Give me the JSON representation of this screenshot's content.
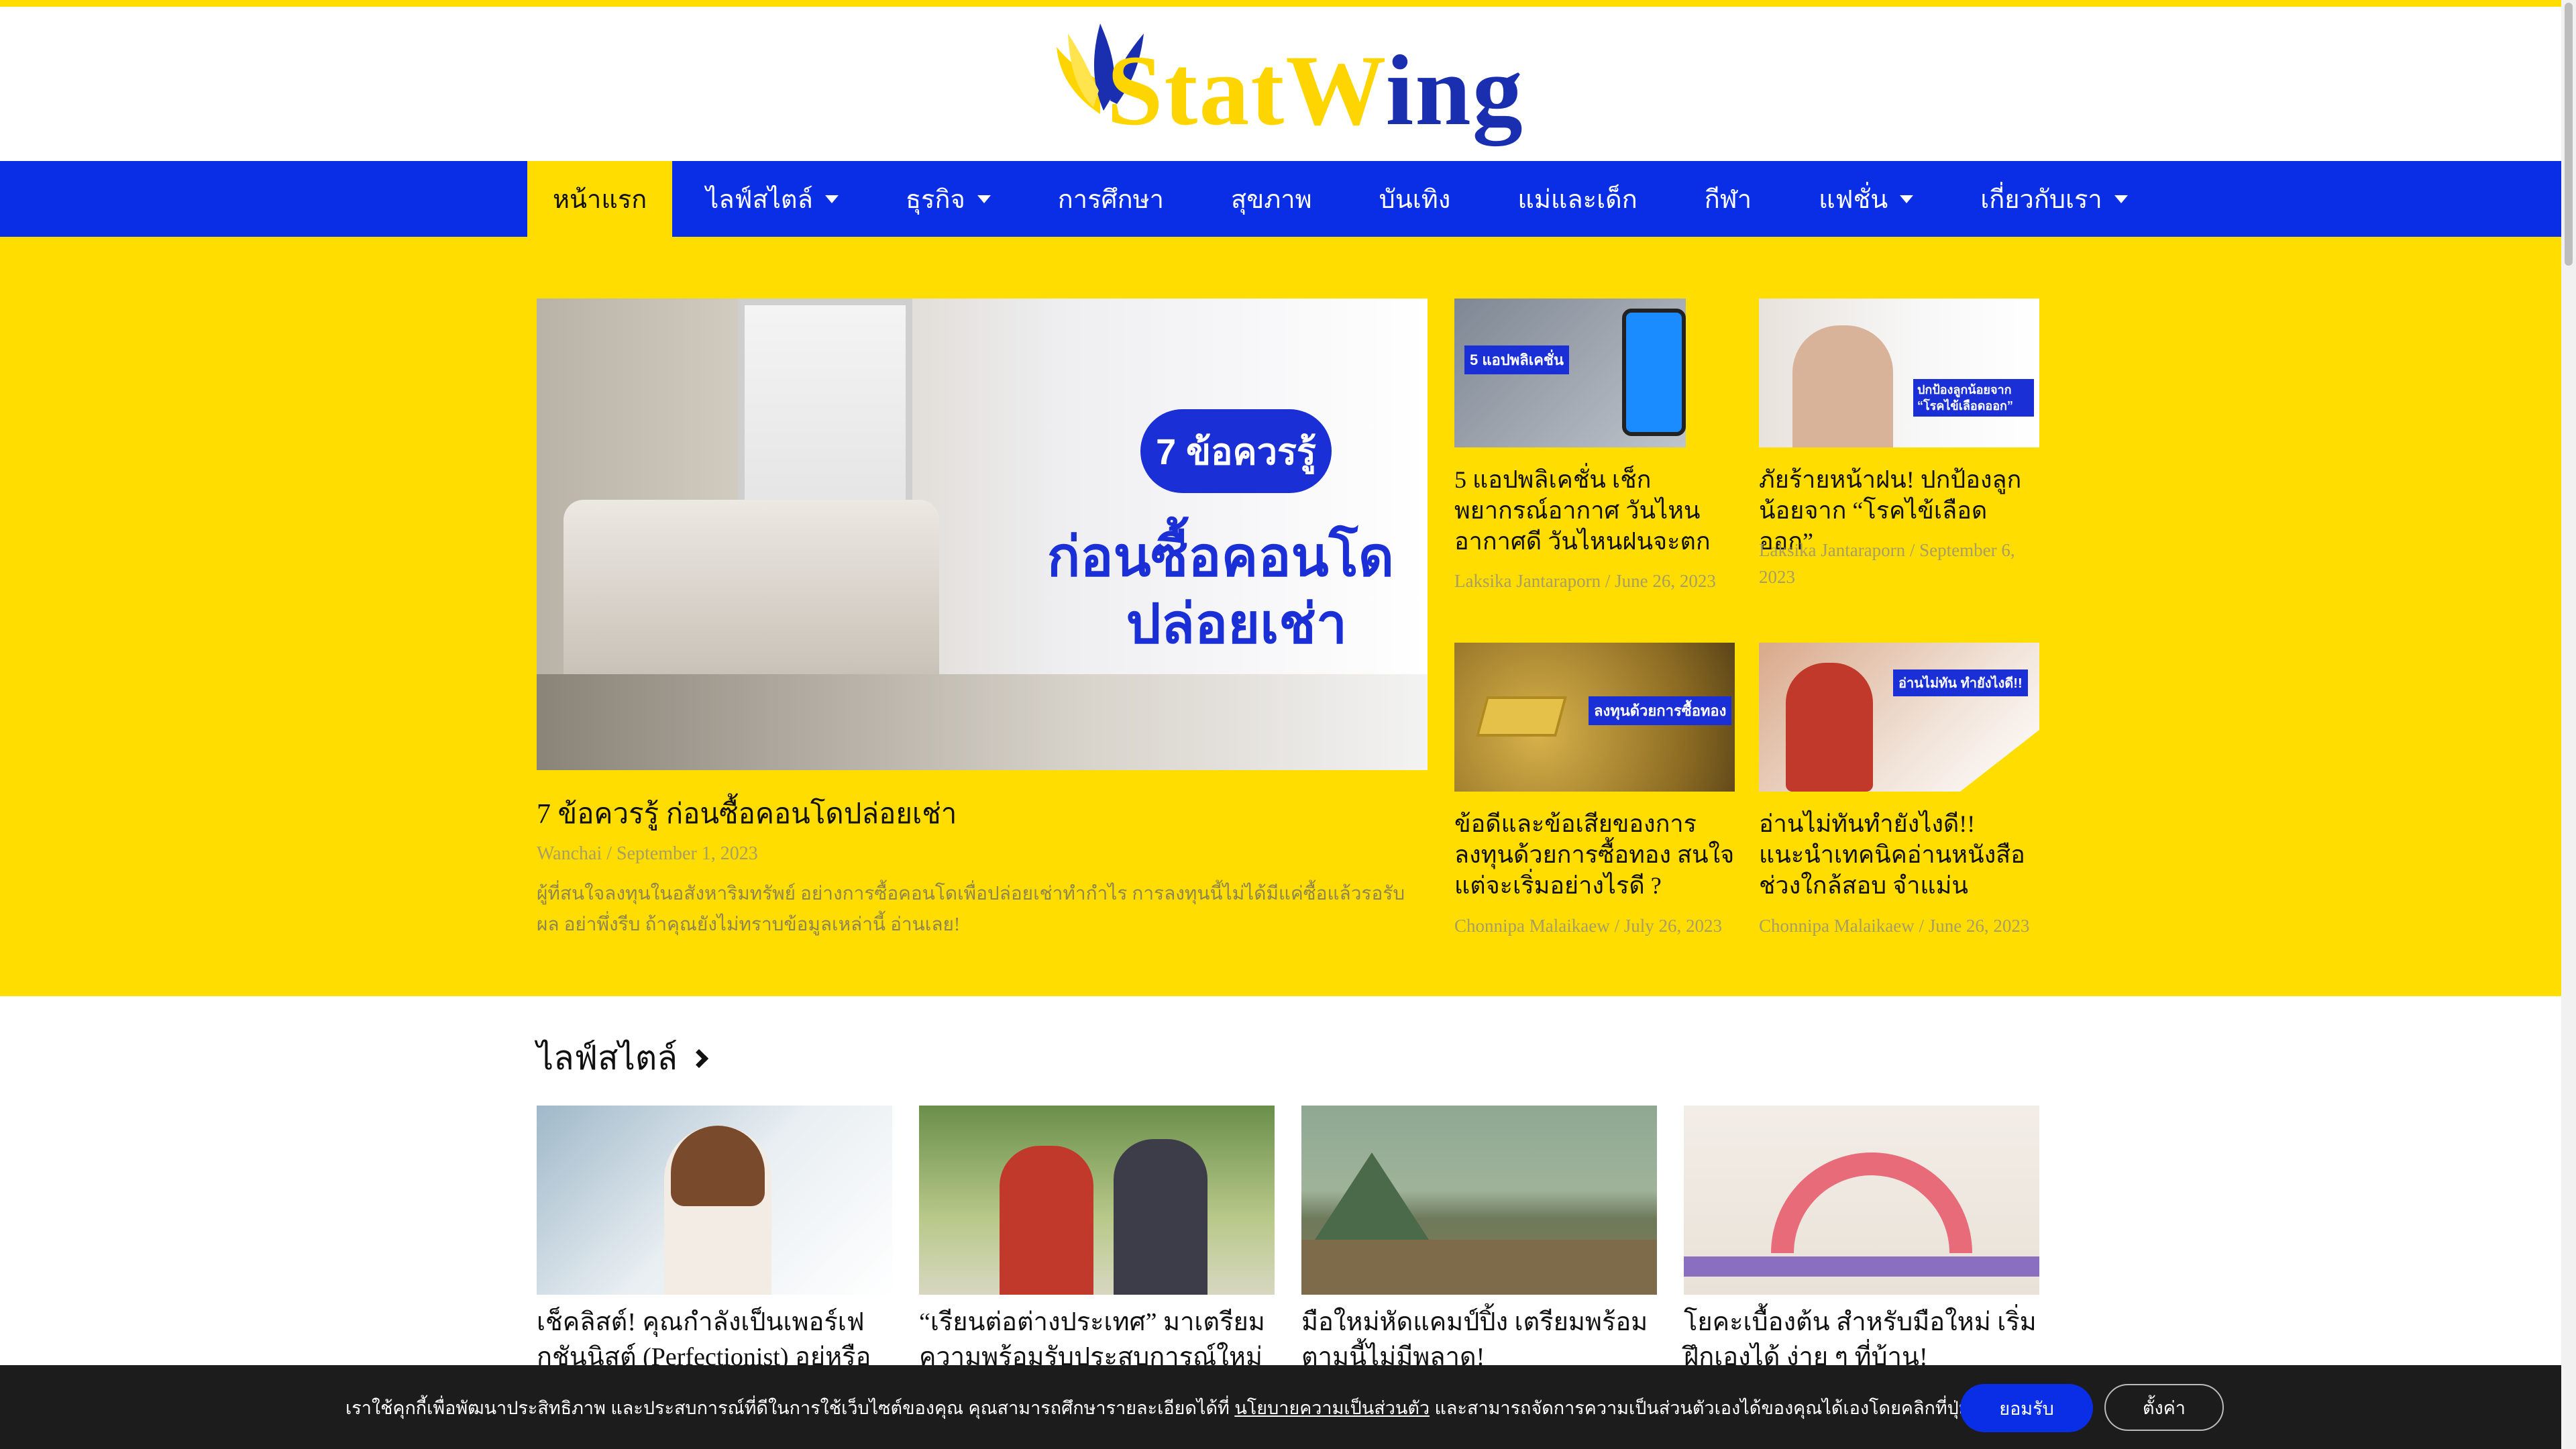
{
  "brand": {
    "logo_left": "Stat",
    "logo_w": "W",
    "logo_right": "ing"
  },
  "nav": [
    {
      "label": "หน้าแรก",
      "active": true,
      "dropdown": false
    },
    {
      "label": "ไลฟ์สไตล์",
      "active": false,
      "dropdown": true
    },
    {
      "label": "ธุรกิจ",
      "active": false,
      "dropdown": true
    },
    {
      "label": "การศึกษา",
      "active": false,
      "dropdown": false
    },
    {
      "label": "สุขภาพ",
      "active": false,
      "dropdown": false
    },
    {
      "label": "บันเทิง",
      "active": false,
      "dropdown": false
    },
    {
      "label": "แม่และเด็ก",
      "active": false,
      "dropdown": false
    },
    {
      "label": "กีฬา",
      "active": false,
      "dropdown": false
    },
    {
      "label": "แฟชั่น",
      "active": false,
      "dropdown": true
    },
    {
      "label": "เกี่ยวกับเรา",
      "active": false,
      "dropdown": true
    }
  ],
  "featured": {
    "image_badge": "7 ข้อควรรู้",
    "image_line1": "ก่อนซื้อคอนโด",
    "image_line2": "ปล่อยเช่า",
    "title": "7 ข้อควรรู้ ก่อนซื้อคอนโดปล่อยเช่า",
    "meta": "Wanchai / September 1, 2023",
    "excerpt": "ผู้ที่สนใจลงทุนในอสังหาริมทรัพย์ อย่างการซื้อคอนโดเพื่อปล่อยเช่าทำกำไร การลงทุนนี้ไม่ได้มีแค่ซื้อแล้วรอรับผล อย่าพึ่งรีบ ถ้าคุณยังไม่ทราบข้อมูลเหล่านี้ อ่านเลย!"
  },
  "cards": [
    {
      "title": "5 แอปพลิเคชั่น เช็กพยากรณ์อากาศ วันไหนอากาศดี วันไหนฝนจะตก",
      "meta": "Laksika Jantaraporn / June 26, 2023",
      "image_text": "5 แอปพลิเคชั่น"
    },
    {
      "title": "ภัยร้ายหน้าฝน! ปกป้องลูกน้อยจาก “โรคไข้เลือดออก”",
      "meta": "Laksika Jantaraporn / September 6, 2023",
      "image_text": "ปกป้องลูกน้อยจาก “โรคไข้เลือดออก”"
    },
    {
      "title": "ข้อดีและข้อเสียของการลงทุนด้วยการซื้อทอง สนใจแต่จะเริ่มอย่างไรดี ?",
      "meta": "Chonnipa Malaikaew / July 26, 2023",
      "image_text": "ลงทุนด้วยการซื้อทอง"
    },
    {
      "title": "อ่านไม่ทันทำยังไงดี!! แนะนำเทคนิคอ่านหนังสือ ช่วงใกล้สอบ จำแม่น",
      "meta": "Chonnipa Malaikaew / June 26, 2023",
      "image_text": "อ่านไม่ทัน ทำยังไงดี!!"
    }
  ],
  "section": {
    "title": "ไลฟ์สไตล์"
  },
  "lifestyle": [
    {
      "title": "เช็คลิสต์! คุณกำลังเป็นเพอร์เฟกชันนิสต์ (Perfectionist) อยู่หรือไม่?"
    },
    {
      "title": "“เรียนต่อต่างประเทศ” มาเตรียมความพร้อมรับประสบการณ์ใหม่กัน!"
    },
    {
      "title": "มือใหม่หัดแคมป์ปิ้ง เตรียมพร้อมตามนี้ไม่มีพลาด!"
    },
    {
      "title": "โยคะเบื้องต้น สำหรับมือใหม่ เริ่มฝึกเองได้ ง่าย ๆ ที่บ้าน!"
    }
  ],
  "cookie": {
    "text_before": "เราใช้คุกกี้เพื่อพัฒนาประสิทธิภาพ และประสบการณ์ที่ดีในการใช้เว็บไซต์ของคุณ คุณสามารถศึกษารายละเอียดได้ที่ ",
    "link": "นโยบายความเป็นส่วนตัว",
    "text_after": " และสามารถจัดการความเป็นส่วนตัวเองได้ของคุณได้เองโดยคลิกที่ปุ่มตั้งค่า",
    "accept": "ยอมรับ",
    "settings": "ตั้งค่า"
  },
  "colors": {
    "brand_yellow": "#ffdd00",
    "brand_blue": "#0a2ee6",
    "meta_text": "#a89d62"
  }
}
